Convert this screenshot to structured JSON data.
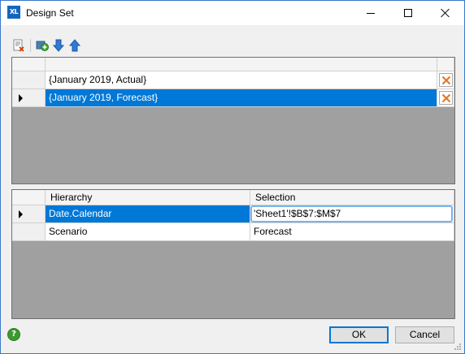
{
  "window": {
    "title": "Design Set",
    "app_icon": "xl-app-icon"
  },
  "toolbar": {
    "items": [
      {
        "name": "clear-list-icon"
      },
      {
        "name": "add-item-icon"
      },
      {
        "name": "move-down-icon"
      },
      {
        "name": "move-up-icon"
      }
    ]
  },
  "sets_grid": {
    "rows": [
      {
        "value": "{January 2019, Actual}",
        "selected": false
      },
      {
        "value": "{January 2019, Forecast}",
        "selected": true
      }
    ]
  },
  "hierarchy_grid": {
    "columns": [
      "Hierarchy",
      "Selection"
    ],
    "rows": [
      {
        "hierarchy": "Date.Calendar",
        "selection": "'Sheet1'!$B$7:$M$7",
        "selected": true
      },
      {
        "hierarchy": "Scenario",
        "selection": "Forecast",
        "selected": false
      }
    ]
  },
  "buttons": {
    "ok": "OK",
    "cancel": "Cancel",
    "help": "?"
  },
  "colors": {
    "selection": "#0078d7",
    "accent_blue": "#3b78c8",
    "delete_orange": "#e87722"
  }
}
